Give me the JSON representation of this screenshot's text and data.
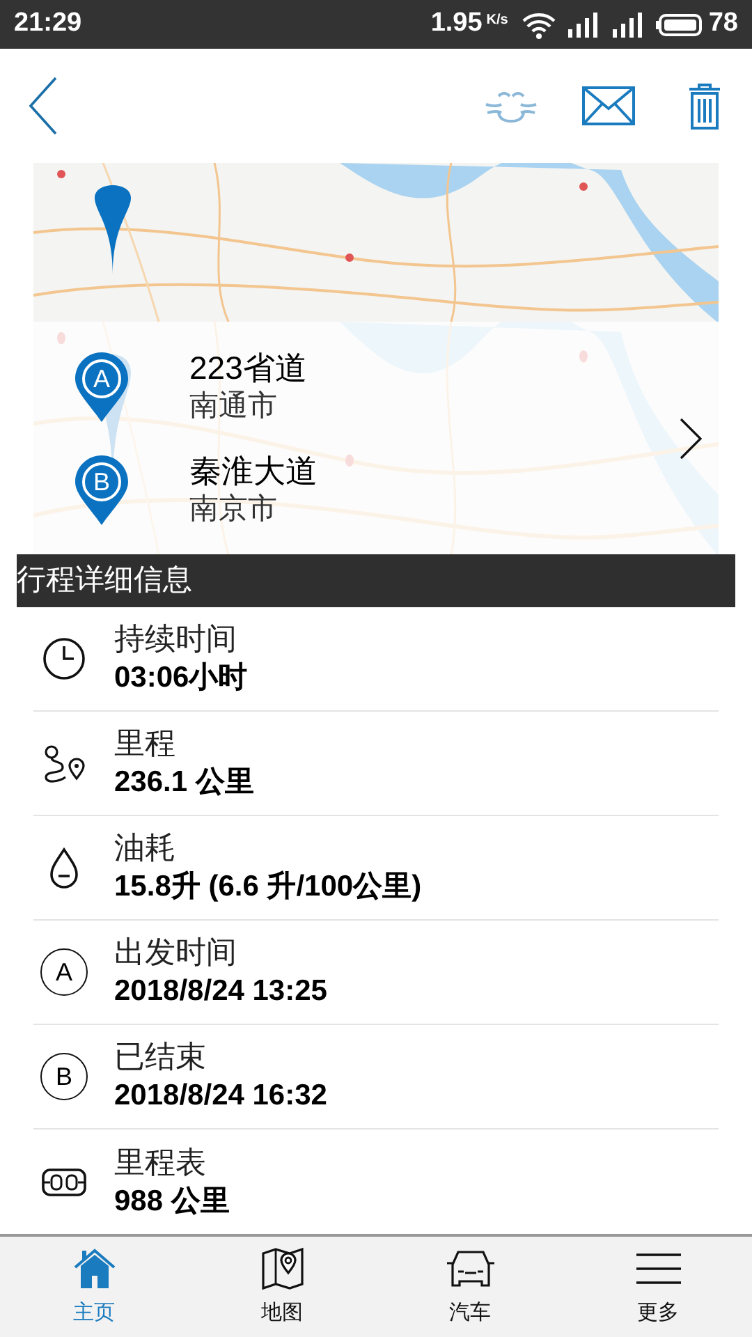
{
  "status_bar": {
    "time": "21:29",
    "speed": "1.95",
    "speed_unit": "K/s",
    "battery": "78"
  },
  "route": {
    "stops": [
      {
        "marker": "A",
        "road": "223省道",
        "city": "南通市"
      },
      {
        "marker": "B",
        "road": "秦淮大道",
        "city": "南京市"
      }
    ]
  },
  "section_title": "行程详细信息",
  "details": [
    {
      "kind": "clock",
      "label": "持续时间",
      "value": "03:06小时"
    },
    {
      "kind": "route",
      "label": "里程",
      "value": "236.1 公里"
    },
    {
      "kind": "drop",
      "label": "油耗",
      "value": "15.8升 (6.6 升/100公里)"
    },
    {
      "kind": "letter",
      "letter": "A",
      "label": "出发时间",
      "value": "2018/8/24 13:25"
    },
    {
      "kind": "letter",
      "letter": "B",
      "label": "已结束",
      "value": "2018/8/24 16:32"
    },
    {
      "kind": "odometer",
      "label": "里程表",
      "value": "988 公里"
    }
  ],
  "tabs": [
    {
      "kind": "home",
      "label": "主页",
      "selected": true
    },
    {
      "kind": "map",
      "label": "地图",
      "selected": false
    },
    {
      "kind": "car",
      "label": "汽车",
      "selected": false
    },
    {
      "kind": "menu",
      "label": "更多",
      "selected": false
    }
  ]
}
